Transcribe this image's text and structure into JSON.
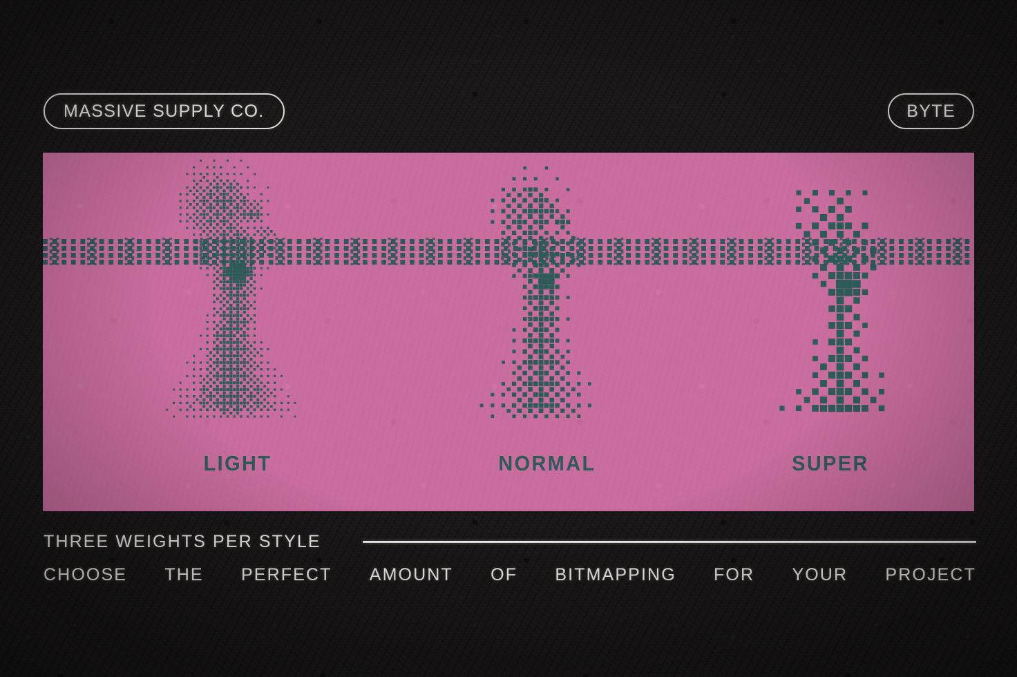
{
  "theme": {
    "background": "#191717",
    "panel_pink": "#c96d9e",
    "ink_teal": "#2c5b58",
    "text_light": "#efece8"
  },
  "header": {
    "brand_label": "MASSIVE SUPPLY CO.",
    "product_label": "BYTE"
  },
  "panel": {
    "specimens": [
      {
        "id": "light",
        "caption": "LIGHT",
        "dot": 3
      },
      {
        "id": "normal",
        "caption": "NORMAL",
        "dot": 5
      },
      {
        "id": "super",
        "caption": "SUPER",
        "dot": 8
      }
    ],
    "band": {
      "name": "dotted-checker-band",
      "rows": 4,
      "cell": 7,
      "pitch": 14
    }
  },
  "footer": {
    "tagline": "THREE WEIGHTS PER STYLE",
    "line_2_words": [
      "CHOOSE",
      "THE",
      "PERFECT",
      "AMOUNT",
      "OF",
      "BITMAPPING",
      "FOR",
      "YOUR",
      "PROJECT"
    ]
  }
}
